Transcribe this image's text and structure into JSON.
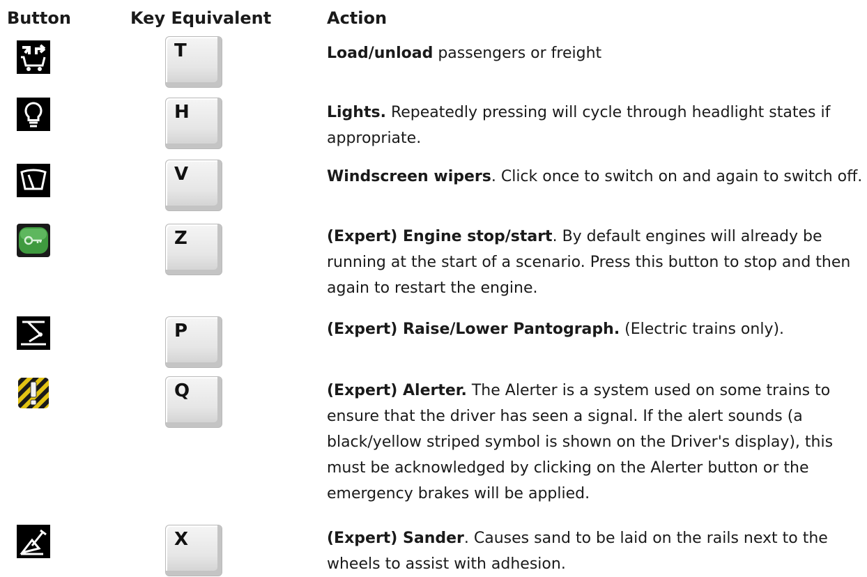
{
  "headers": {
    "button": "Button",
    "key": "Key Equivalent",
    "action": "Action"
  },
  "rows": [
    {
      "icon": "load-unload-icon",
      "key": "T",
      "bold": "Load/unload",
      "text": " passengers or freight"
    },
    {
      "icon": "lightbulb-icon",
      "key": "H",
      "bold": "Lights.",
      "text": " Repeatedly pressing will cycle through headlight states if appropriate."
    },
    {
      "icon": "wiper-icon",
      "key": "V",
      "bold": "Windscreen wipers",
      "text": ". Click once to switch on and again to switch off."
    },
    {
      "icon": "engine-key-icon",
      "key": "Z",
      "bold": "(Expert) Engine stop/start",
      "text": ". By default engines will already be running at the start of a scenario. Press this button to stop and then again to restart the engine."
    },
    {
      "icon": "pantograph-icon",
      "key": "P",
      "bold": "(Expert) Raise/Lower Pantograph.",
      "text": " (Electric trains only)."
    },
    {
      "icon": "alerter-icon",
      "key": "Q",
      "bold": "(Expert) Alerter.",
      "text": " The Alerter is a system used on some trains to ensure that the driver has seen a signal. If the alert sounds (a black/yellow striped symbol is shown on the Driver's display), this must be acknowledged by clicking on the Alerter button or the emergency brakes will be applied."
    },
    {
      "icon": "sander-icon",
      "key": "X",
      "bold": "(Expert) Sander",
      "text": ". Causes sand to be laid on the rails next to the wheels to assist with adhesion."
    }
  ]
}
